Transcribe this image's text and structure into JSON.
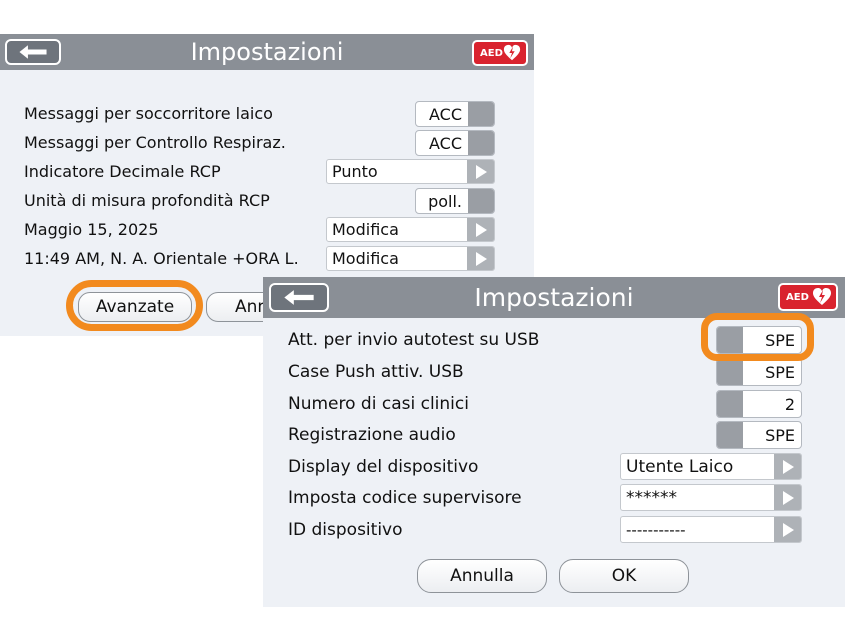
{
  "colors": {
    "accent_highlight": "#f28a1e",
    "aed_badge": "#d9232e",
    "titlebar": "#8a8f96"
  },
  "panel1": {
    "title": "Impostazioni",
    "aed_badge": "AED",
    "rows": [
      {
        "label": "Messaggi per soccorritore laico",
        "value": "ACC"
      },
      {
        "label": "Messaggi per Controllo Respiraz.",
        "value": "ACC"
      },
      {
        "label": "Indicatore Decimale RCP",
        "value": "Punto"
      },
      {
        "label": "Unità di misura profondità RCP",
        "value": "poll."
      },
      {
        "label": "Maggio 15, 2025",
        "value": "Modifica"
      },
      {
        "label": "11:49 AM, N. A. Orientale  +ORA L.",
        "value": "Modifica"
      }
    ],
    "advanced_button": "Avanzate",
    "cancel_button": "Ann"
  },
  "panel2": {
    "title": "Impostazioni",
    "aed_badge": "AED",
    "rows": [
      {
        "label": "Att. per invio autotest su USB",
        "value": "SPE"
      },
      {
        "label": "Case Push attiv. USB",
        "value": "SPE"
      },
      {
        "label": "Numero di casi clinici",
        "value": "2"
      },
      {
        "label": "Registrazione audio",
        "value": "SPE"
      },
      {
        "label": "Display del dispositivo",
        "value": "Utente Laico"
      },
      {
        "label": "Imposta codice supervisore",
        "value": "******"
      },
      {
        "label": "ID dispositivo",
        "value": "-----------"
      }
    ],
    "cancel_button": "Annulla",
    "ok_button": "OK"
  }
}
